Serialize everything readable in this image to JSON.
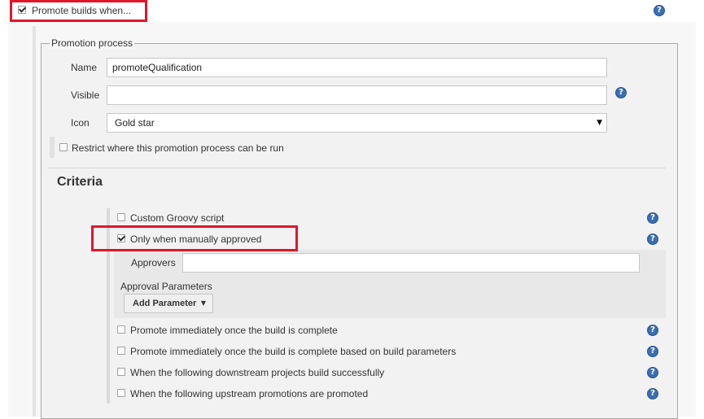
{
  "promote": {
    "label": "Promote builds when...",
    "checked": true
  },
  "process": {
    "legend": "Promotion process",
    "name_label": "Name",
    "name_value": "promoteQualification",
    "visible_label": "Visible",
    "visible_value": "",
    "icon_label": "Icon",
    "icon_value": "Gold star",
    "restrict_label": "Restrict where this promotion process can be run"
  },
  "criteria": {
    "heading": "Criteria",
    "custom_groovy": "Custom Groovy script",
    "manual": "Only when manually approved",
    "approvers_label": "Approvers",
    "approvers_value": "",
    "approval_params_label": "Approval Parameters",
    "add_parameter": "Add Parameter",
    "immediate": "Promote immediately once the build is complete",
    "immediate_params": "Promote immediately once the build is complete based on build parameters",
    "downstream": "When the following downstream projects build successfully",
    "upstream": "When the following upstream promotions are promoted"
  },
  "icons": {
    "help": "?",
    "dropdown": "▼"
  },
  "colors": {
    "highlight": "#e0162b",
    "help": "#3a6fb0"
  }
}
